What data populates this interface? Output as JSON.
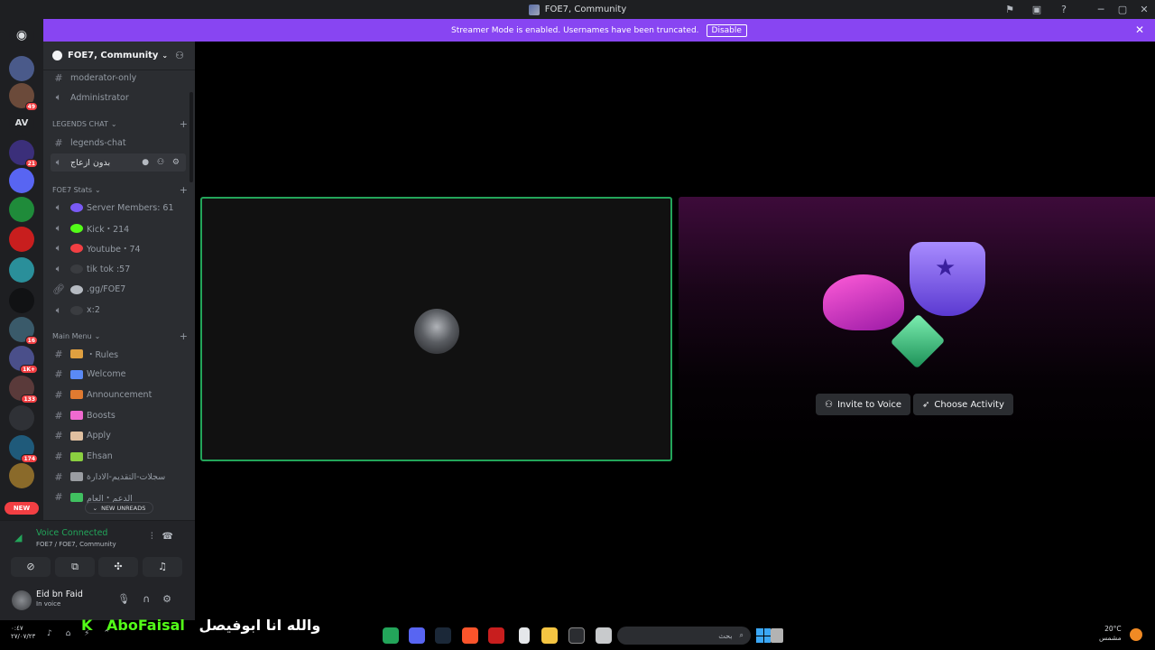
{
  "window": {
    "title": "FOE7, Community",
    "icons": [
      "inbox-icon",
      "display-icon",
      "help-icon"
    ],
    "controls": [
      "─",
      "▢",
      "✕"
    ]
  },
  "banner": {
    "text": "Streamer Mode is enabled. Usernames have been truncated.",
    "button": "Disable"
  },
  "rail": {
    "servers": [
      {
        "label": "",
        "color": "#4a5a8a",
        "badge": ""
      },
      {
        "label": "",
        "color": "#6b4a3a",
        "badge": "49"
      },
      {
        "label": "AV",
        "color": "#1e1f22",
        "badge": ""
      },
      {
        "label": "",
        "color": "#3b2f7a",
        "badge": "21"
      },
      {
        "label": "",
        "color": "#5865f2",
        "badge": ""
      },
      {
        "label": "",
        "color": "#1f8b3a",
        "badge": ""
      },
      {
        "label": "",
        "color": "#c81e1e",
        "badge": ""
      },
      {
        "label": "",
        "color": "#2a8f9a",
        "badge": ""
      },
      {
        "label": "",
        "color": "#111214",
        "badge": ""
      },
      {
        "label": "",
        "color": "#3a5a6a",
        "badge": "16"
      },
      {
        "label": "",
        "color": "#4a4f8a",
        "badge": "1K+"
      },
      {
        "label": "",
        "color": "#5a3a3a",
        "badge": "133"
      },
      {
        "label": "",
        "color": "#2f3136",
        "badge": ""
      },
      {
        "label": "",
        "color": "#1f5a7a",
        "badge": "174"
      },
      {
        "label": "",
        "color": "#8a6a2a",
        "badge": ""
      }
    ],
    "new_label": "NEW"
  },
  "server": {
    "name": "FOE7, Community"
  },
  "channels": {
    "top": [
      {
        "name": "moderator-only",
        "type": "text"
      },
      {
        "name": "Administrator",
        "type": "voice"
      }
    ],
    "legends": {
      "category": "LEGENDS CHAT",
      "items": [
        {
          "name": "legends-chat",
          "type": "text"
        },
        {
          "name": "بدون ازعاج",
          "type": "voice"
        }
      ]
    },
    "stats": {
      "category": "FOE7 Stats",
      "items": [
        {
          "name": "Server Members: 61",
          "emoji_color": "#7a5af5"
        },
        {
          "name": "Kick・214",
          "emoji_color": "#53fc18"
        },
        {
          "name": "Youtube・74",
          "emoji_color": "#f23f43"
        },
        {
          "name": "tik tok :57",
          "emoji_color": "#3a3c40"
        },
        {
          "name": ".gg/FOE7",
          "emoji_color": "#b5bac1"
        },
        {
          "name": "x:2",
          "emoji_color": "#3a3c40"
        }
      ]
    },
    "main_menu": {
      "category": "Main Menu",
      "items": [
        {
          "name": "・Rules",
          "emoji_color": "#e0a040"
        },
        {
          "name": "Welcome",
          "emoji_color": "#5a8af5"
        },
        {
          "name": "Announcement",
          "emoji_color": "#e07a30"
        },
        {
          "name": "Boosts",
          "emoji_color": "#f06ad0"
        },
        {
          "name": "Apply",
          "emoji_color": "#e0c0a0"
        },
        {
          "name": "Ehsan",
          "emoji_color": "#8ad040"
        },
        {
          "name": "سجلات-التقديم-الادارة",
          "emoji_color": "#9a9da2"
        },
        {
          "name": "الدعم・العام",
          "emoji_color": "#40c060"
        }
      ]
    },
    "new_unreads": "NEW UNREADS"
  },
  "voice_panel": {
    "status": "Voice Connected",
    "channel": "FOE7 / FOE7, Community",
    "buttons": [
      "camera-off-icon",
      "screen-share-icon",
      "activities-icon",
      "soundboard-icon"
    ]
  },
  "user": {
    "name": "Eid bn Faid",
    "status": "In voice"
  },
  "stage": {
    "invite_label": "Invite to Voice",
    "activity_label": "Choose Activity"
  },
  "taskbar": {
    "time": "٠:٤٧",
    "date": "٢٧/٠٧/٢٣",
    "overlay_name": "AboFaisal",
    "overlay_arabic": "والله انا ابوفيصل",
    "search_placeholder": "بحث",
    "weather_temp": "20°C",
    "weather_desc": "مشمس"
  }
}
